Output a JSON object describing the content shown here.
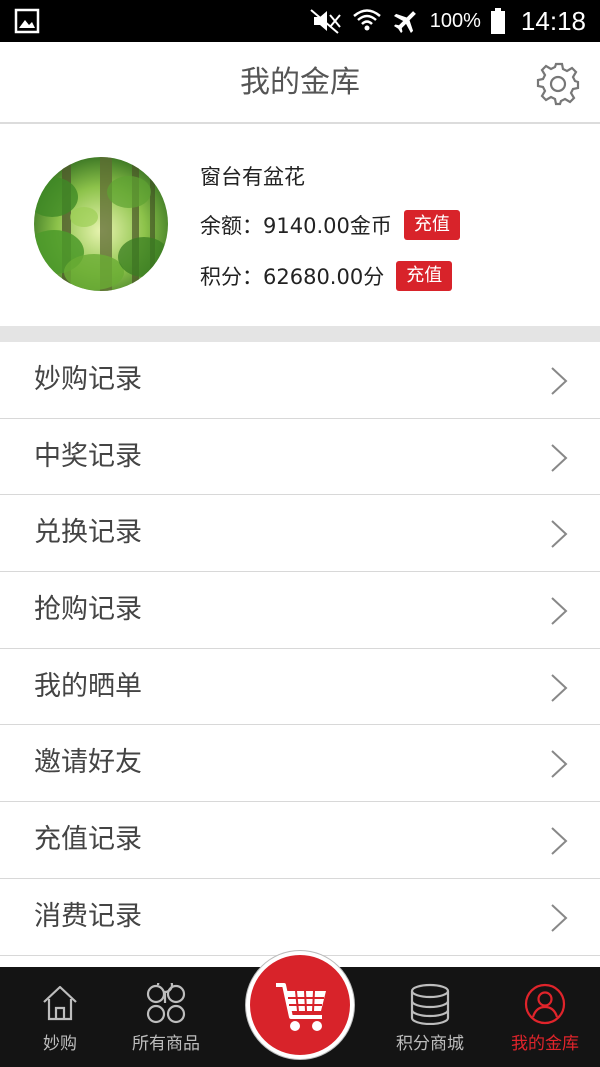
{
  "status_bar": {
    "battery_percent": "100%",
    "time": "14:18"
  },
  "header": {
    "title": "我的金库"
  },
  "profile": {
    "username": "窗台有盆花",
    "balance_label": "余额：",
    "balance_value": "9140.00金币",
    "points_label": "积分：",
    "points_value": "62680.00分",
    "charge_label": "充值"
  },
  "menu": {
    "items": [
      {
        "label": "妙购记录"
      },
      {
        "label": "中奖记录"
      },
      {
        "label": "兑换记录"
      },
      {
        "label": "抢购记录"
      },
      {
        "label": "我的晒单"
      },
      {
        "label": "邀请好友"
      },
      {
        "label": "充值记录"
      },
      {
        "label": "消费记录"
      }
    ]
  },
  "bottom_nav": {
    "items": [
      {
        "label": "妙购",
        "icon": "home-icon"
      },
      {
        "label": "所有商品",
        "icon": "grid-icon"
      },
      {
        "label": "积分商城",
        "icon": "coins-icon"
      },
      {
        "label": "我的金库",
        "icon": "user-icon",
        "active": true
      }
    ],
    "center_icon": "cart-icon"
  },
  "colors": {
    "accent_red": "#d8232a",
    "nav_background": "#141414",
    "active_nav": "#e0242b"
  }
}
